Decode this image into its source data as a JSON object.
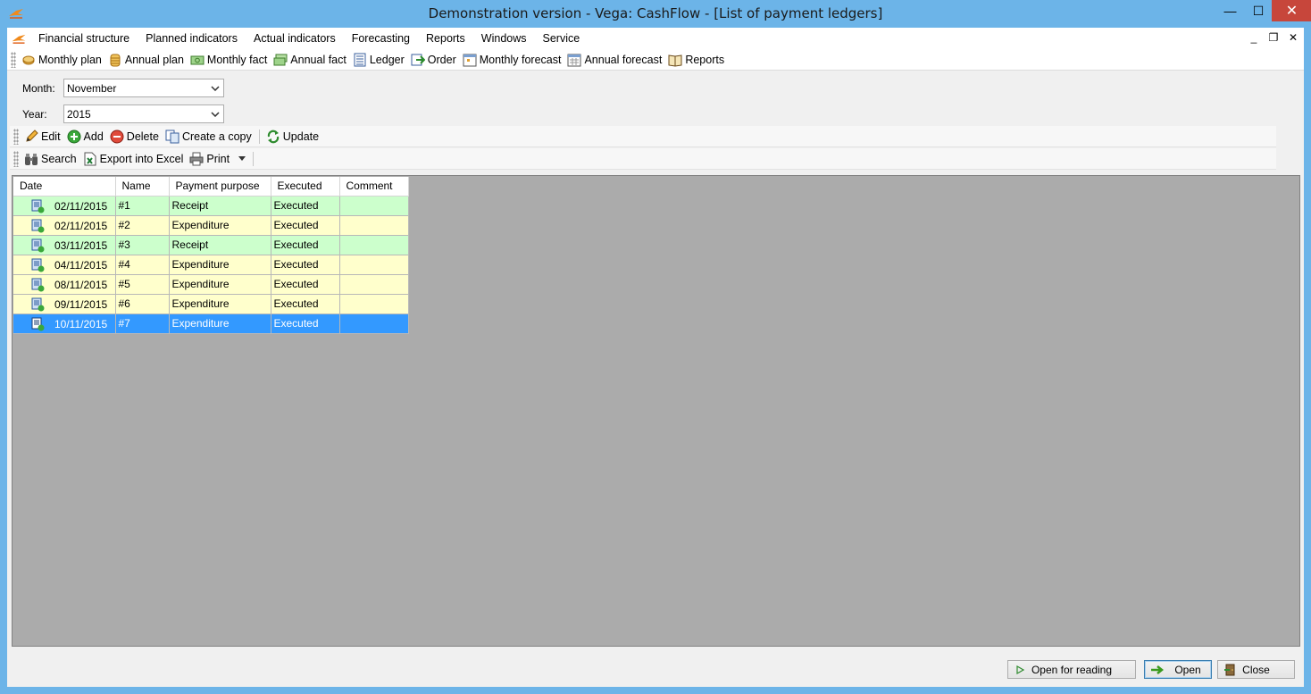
{
  "window": {
    "title": "Demonstration version - Vega: CashFlow - [List of payment ledgers]",
    "controls": {
      "minimize": "—",
      "maximize": "☐",
      "close": "✕"
    }
  },
  "menu": {
    "items": [
      "Financial structure",
      "Planned indicators",
      "Actual indicators",
      "Forecasting",
      "Reports",
      "Windows",
      "Service"
    ],
    "mdi": {
      "minimize": "_",
      "restore": "❐",
      "close": "✕"
    }
  },
  "toolbar": {
    "items": [
      {
        "label": "Monthly plan",
        "icon": "coins-icon"
      },
      {
        "label": "Annual plan",
        "icon": "coin-stack-icon"
      },
      {
        "label": "Monthly fact",
        "icon": "banknote-icon"
      },
      {
        "label": "Annual fact",
        "icon": "banknotes-icon"
      },
      {
        "label": "Ledger",
        "icon": "ledger-icon"
      },
      {
        "label": "Order",
        "icon": "order-arrow-icon"
      },
      {
        "label": "Monthly forecast",
        "icon": "calendar-month-icon"
      },
      {
        "label": "Annual forecast",
        "icon": "calendar-year-icon"
      },
      {
        "label": "Reports",
        "icon": "book-icon"
      }
    ]
  },
  "filters": {
    "month_label": "Month:",
    "month_value": "November",
    "year_label": "Year:",
    "year_value": "2015"
  },
  "actions": {
    "edit": "Edit",
    "add": "Add",
    "delete": "Delete",
    "copy": "Create a copy",
    "update": "Update",
    "search": "Search",
    "export": "Export into Excel",
    "print": "Print"
  },
  "grid": {
    "columns": [
      "Date",
      "Name",
      "Payment purpose",
      "Executed",
      "Comment"
    ],
    "rows": [
      {
        "date": "02/11/2015",
        "name": "#1",
        "purpose": "Receipt",
        "executed": "Executed",
        "comment": ""
      },
      {
        "date": "02/11/2015",
        "name": "#2",
        "purpose": "Expenditure",
        "executed": "Executed",
        "comment": ""
      },
      {
        "date": "03/11/2015",
        "name": "#3",
        "purpose": "Receipt",
        "executed": "Executed",
        "comment": ""
      },
      {
        "date": "04/11/2015",
        "name": "#4",
        "purpose": "Expenditure",
        "executed": "Executed",
        "comment": ""
      },
      {
        "date": "08/11/2015",
        "name": "#5",
        "purpose": "Expenditure",
        "executed": "Executed",
        "comment": ""
      },
      {
        "date": "09/11/2015",
        "name": "#6",
        "purpose": "Expenditure",
        "executed": "Executed",
        "comment": ""
      },
      {
        "date": "10/11/2015",
        "name": "#7",
        "purpose": "Expenditure",
        "executed": "Executed",
        "comment": ""
      }
    ],
    "selected_row": 6,
    "colors": {
      "receipt": "#ccffcc",
      "expenditure": "#ffffcc",
      "selected": "#3399ff"
    }
  },
  "buttons": {
    "open_for_reading": "Open for reading",
    "open": "Open",
    "close": "Close"
  }
}
